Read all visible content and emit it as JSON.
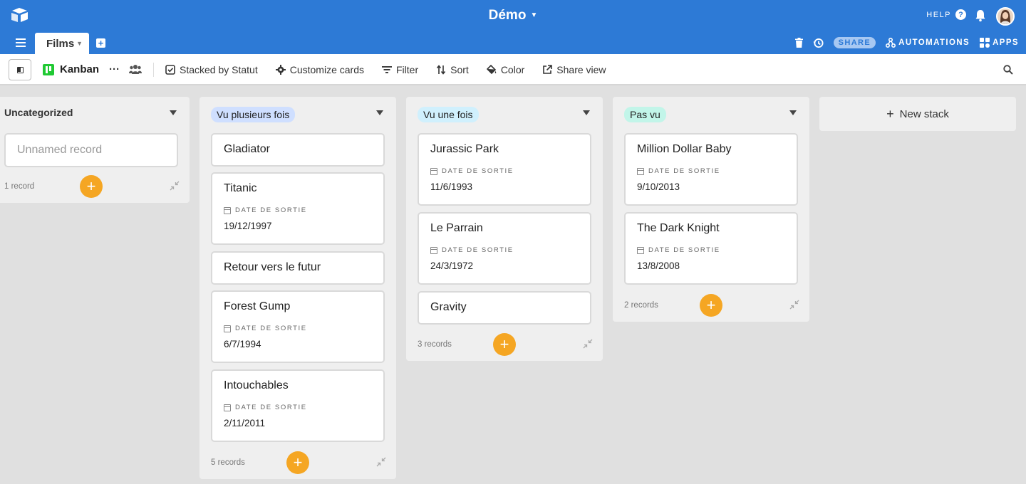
{
  "app": {
    "base_title": "Démo",
    "help_label": "HELP",
    "tab": "Films"
  },
  "toolbar_right": {
    "share": "SHARE",
    "automations": "AUTOMATIONS",
    "apps": "APPS"
  },
  "view": {
    "name": "Kanban",
    "actions": {
      "stacked": "Stacked by Statut",
      "customize": "Customize cards",
      "filter": "Filter",
      "sort": "Sort",
      "color": "Color",
      "share_view": "Share view"
    }
  },
  "field_label": "DATE DE SORTIE",
  "stacks": [
    {
      "title": "Uncategorized",
      "placeholder": "Unnamed record",
      "count": "1 record"
    },
    {
      "title": "Vu plusieurs fois",
      "pill_color": "#cfdfff",
      "count": "5 records",
      "cards": [
        {
          "title": "Gladiator",
          "date": ""
        },
        {
          "title": "Titanic",
          "date": "19/12/1997"
        },
        {
          "title": "Retour vers le futur",
          "date": ""
        },
        {
          "title": "Forest Gump",
          "date": "6/7/1994"
        },
        {
          "title": "Intouchables",
          "date": "2/11/2011"
        }
      ]
    },
    {
      "title": "Vu une fois",
      "pill_color": "#d0f0fd",
      "count": "3 records",
      "cards": [
        {
          "title": "Jurassic Park",
          "date": "11/6/1993"
        },
        {
          "title": "Le Parrain",
          "date": "24/3/1972"
        },
        {
          "title": "Gravity",
          "date": ""
        }
      ]
    },
    {
      "title": "Pas vu",
      "pill_color": "#c2f5e9",
      "count": "2 records",
      "cards": [
        {
          "title": "Million Dollar Baby",
          "date": "9/10/2013"
        },
        {
          "title": "The Dark Knight",
          "date": "13/8/2008"
        }
      ]
    }
  ],
  "new_stack": "New stack",
  "colors": {
    "header": "#2d7ad6",
    "add_button": "#f5a623"
  }
}
